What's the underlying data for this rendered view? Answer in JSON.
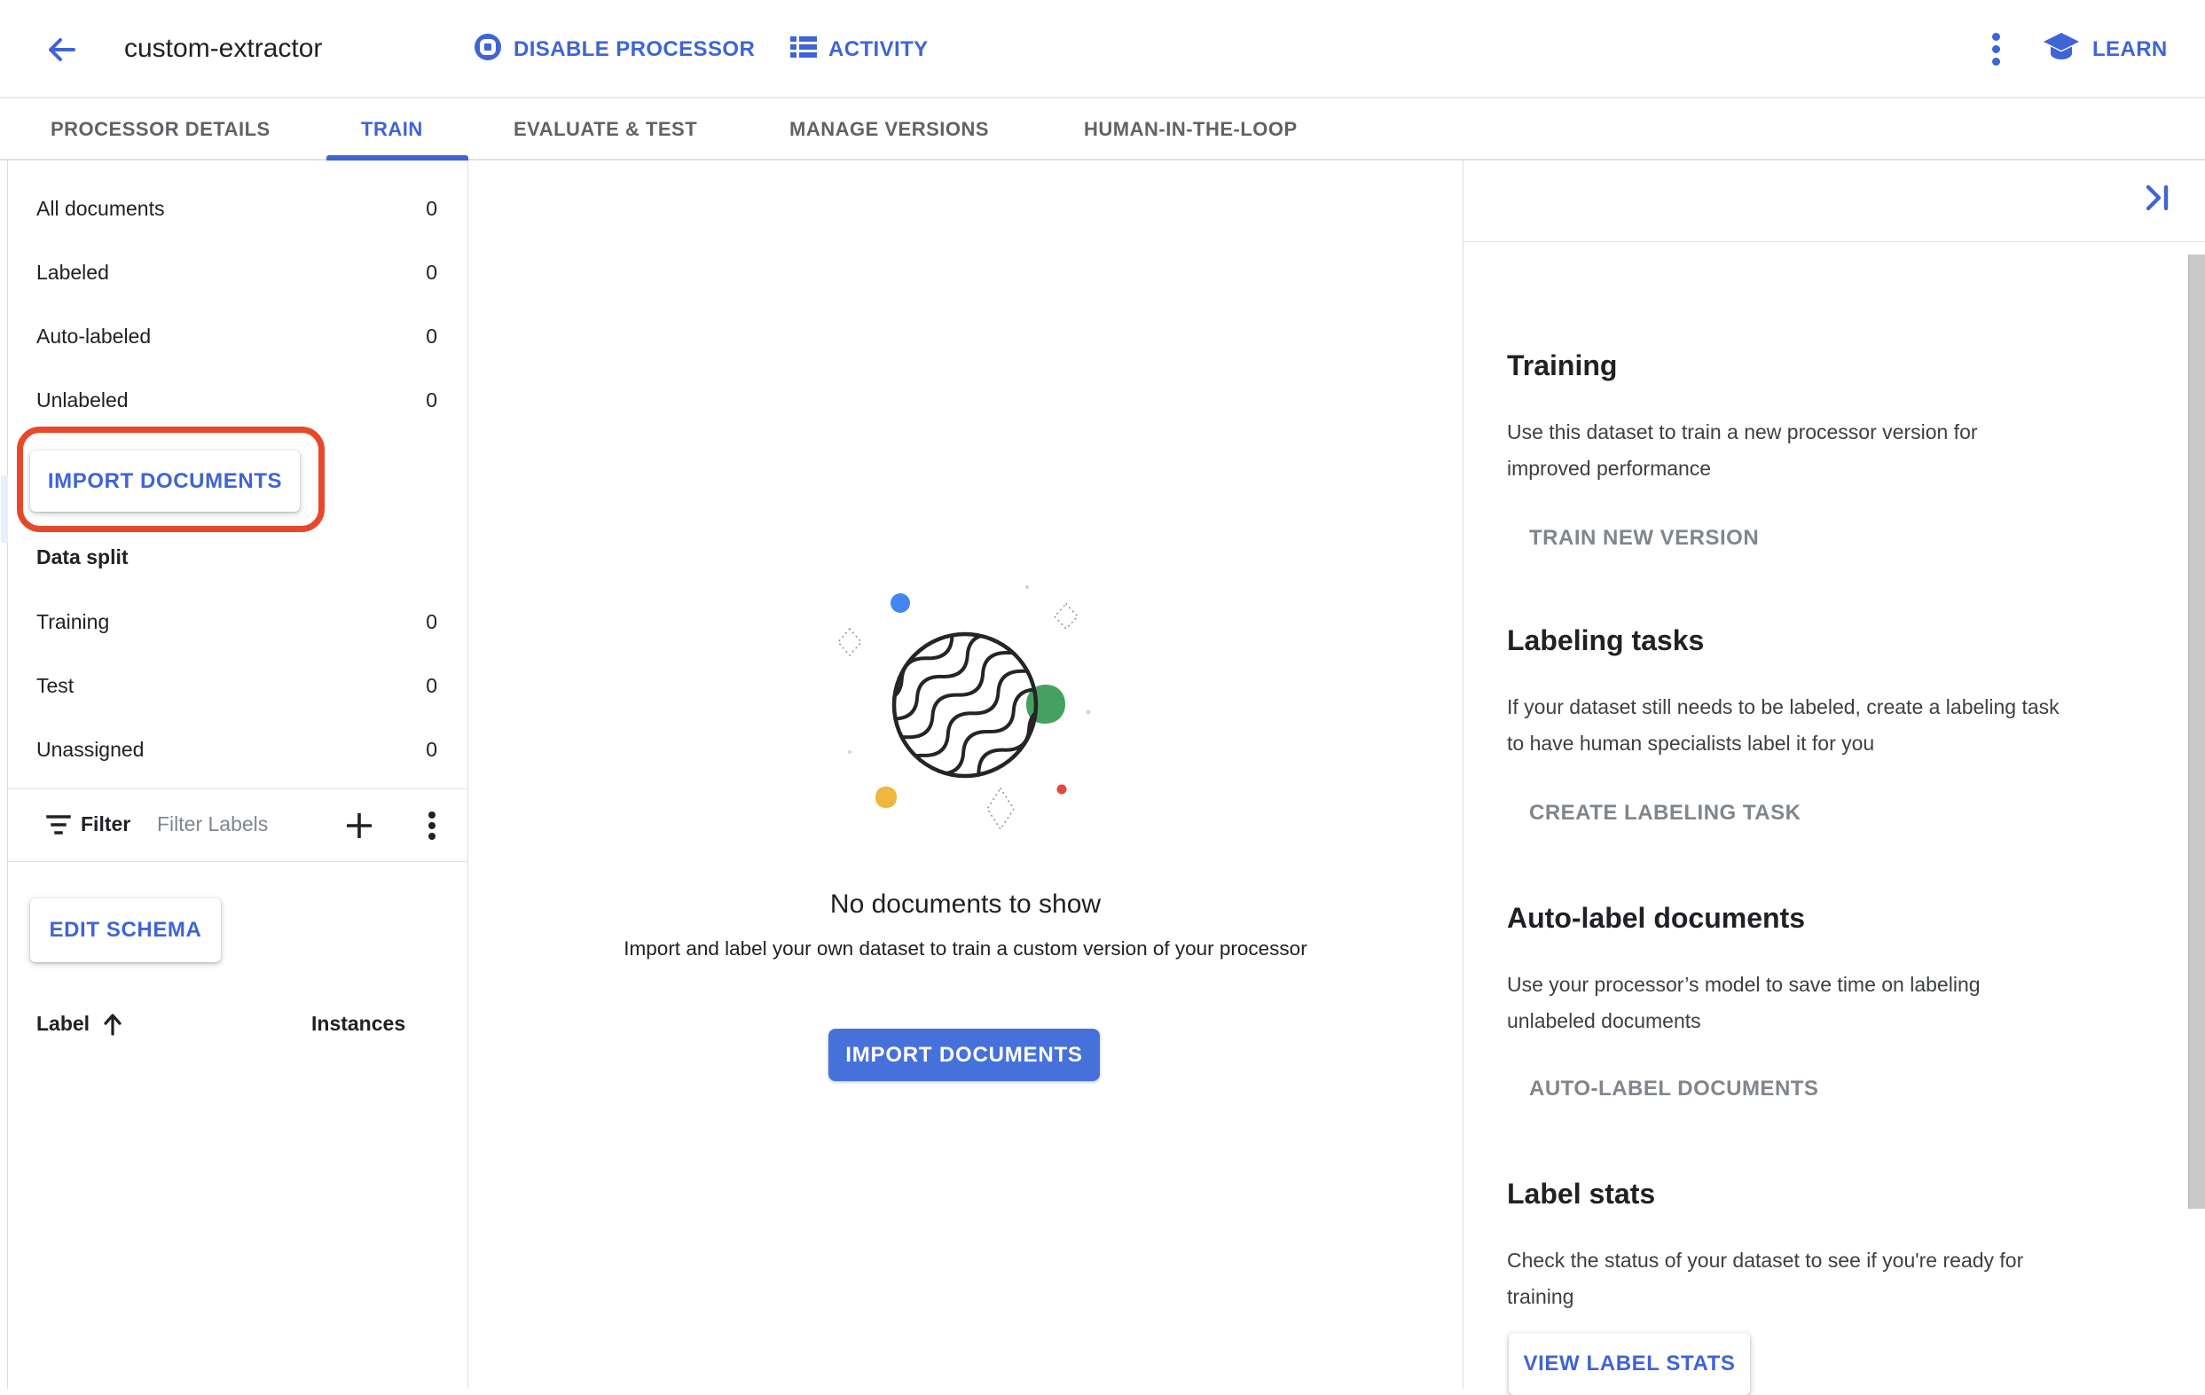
{
  "header": {
    "title": "custom-extractor",
    "disable_processor_label": "DISABLE PROCESSOR",
    "activity_label": "ACTIVITY",
    "learn_label": "LEARN"
  },
  "tabs": {
    "labels": [
      "PROCESSOR DETAILS",
      "TRAIN",
      "EVALUATE & TEST",
      "MANAGE VERSIONS",
      "HUMAN-IN-THE-LOOP"
    ],
    "active": "TRAIN"
  },
  "sidebar": {
    "doc_counts": [
      {
        "label": "All documents",
        "count": "0"
      },
      {
        "label": "Labeled",
        "count": "0"
      },
      {
        "label": "Auto-labeled",
        "count": "0"
      },
      {
        "label": "Unlabeled",
        "count": "0"
      }
    ],
    "import_button": "IMPORT DOCUMENTS",
    "data_split_heading": "Data split",
    "split_rows": [
      {
        "label": "Training",
        "count": "0"
      },
      {
        "label": "Test",
        "count": "0"
      },
      {
        "label": "Unassigned",
        "count": "0"
      }
    ],
    "filter_label": "Filter",
    "filter_placeholder": "Filter Labels",
    "edit_schema_button": "EDIT SCHEMA",
    "table": {
      "col_label": "Label",
      "col_instances": "Instances"
    }
  },
  "empty_state": {
    "title": "No documents to show",
    "subtitle": "Import and label your own dataset to train a custom version of your processor",
    "import_button": "IMPORT DOCUMENTS"
  },
  "panel": {
    "sections": [
      {
        "heading": "Training",
        "body_lines": [
          "Use this dataset to train a new processor version for",
          "improved performance"
        ],
        "action": "TRAIN NEW VERSION"
      },
      {
        "heading": "Labeling tasks",
        "body_lines": [
          "If your dataset still needs to be labeled, create a labeling task",
          "to have human specialists label it for you"
        ],
        "action": "CREATE LABELING TASK"
      },
      {
        "heading": "Auto-label documents",
        "body_lines": [
          "Use your processor’s model to save time on labeling",
          "unlabeled documents"
        ],
        "action": "AUTO-LABEL DOCUMENTS"
      },
      {
        "heading": "Label stats",
        "body_lines": [
          "Check the status of your dataset to see if you're ready for",
          "training"
        ],
        "action": "VIEW LABEL STATS"
      }
    ]
  },
  "colors": {
    "accent": "#3e64d6",
    "primary_button": "#4671da",
    "annotation": "#e8472b",
    "divider": "#e0e0e0",
    "disabled_text": "#80868b",
    "illustration_blue": "#4285f4",
    "illustration_green": "#45a161",
    "illustration_yellow": "#efb73e",
    "illustration_red": "#e2483d"
  }
}
